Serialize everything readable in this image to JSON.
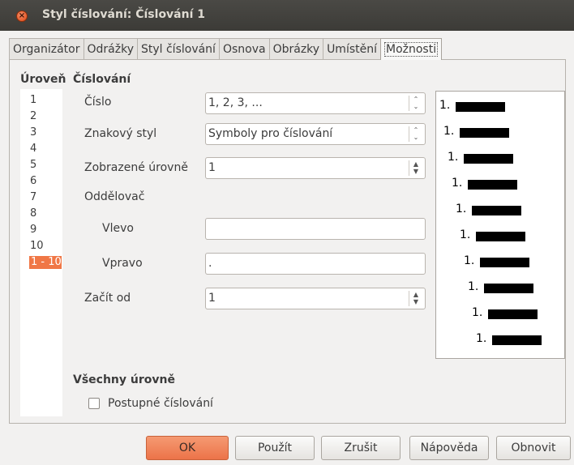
{
  "window": {
    "title": "Styl číslování: Číslování 1",
    "close_glyph": "×"
  },
  "tabs": [
    {
      "label": "Organizátor"
    },
    {
      "label": "Odrážky"
    },
    {
      "label": "Styl číslování"
    },
    {
      "label": "Osnova"
    },
    {
      "label": "Obrázky"
    },
    {
      "label": "Umístění"
    },
    {
      "label": "Možnosti",
      "active": true
    }
  ],
  "level": {
    "heading": "Úroveň",
    "items": [
      "1",
      "2",
      "3",
      "4",
      "5",
      "6",
      "7",
      "8",
      "9",
      "10",
      "1 - 10"
    ],
    "selected": "1 - 10"
  },
  "numbering": {
    "heading": "Číslování",
    "cislo_label": "Číslo",
    "cislo_value": "1, 2, 3, ...",
    "znakovy_styl_label": "Znakový styl",
    "znakovy_styl_value": "Symboly pro číslování",
    "zobrazene_urovne_label": "Zobrazené úrovně",
    "zobrazene_urovne_value": "1",
    "oddelovac_label": "Oddělovač",
    "vlevo_label": "Vlevo",
    "vlevo_value": "",
    "vpravo_label": "Vpravo",
    "vpravo_value": ".",
    "zacit_od_label": "Začít od",
    "zacit_od_value": "1"
  },
  "preview": {
    "number": "1.",
    "rows": 10
  },
  "all_levels": {
    "heading": "Všechny úrovně",
    "consecutive_label": "Postupné číslování",
    "consecutive_checked": false
  },
  "buttons": {
    "ok": "OK",
    "apply": "Použít",
    "cancel": "Zrušit",
    "help": "Nápověda",
    "reset": "Obnovit"
  },
  "colors": {
    "accent": "#f07746",
    "titlebar": "#3c3b37"
  }
}
